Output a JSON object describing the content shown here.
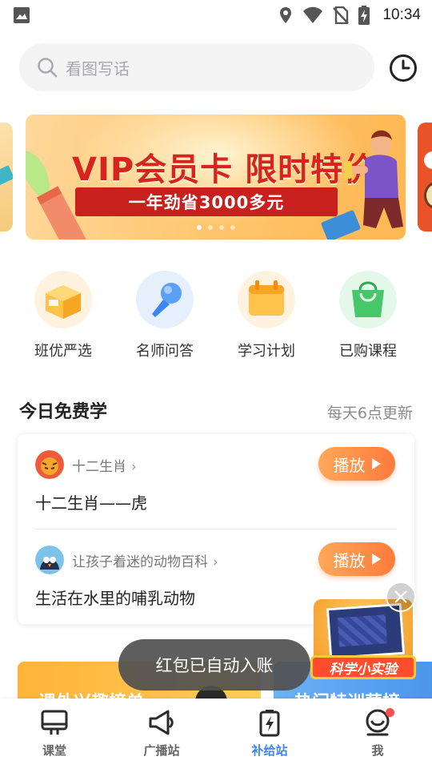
{
  "status_bar": {
    "time": "10:34",
    "icons": [
      "image-icon",
      "location-icon",
      "wifi-icon",
      "no-sim-icon",
      "battery-charging-icon"
    ]
  },
  "search": {
    "placeholder": "看图写话",
    "history_icon": "clock-icon"
  },
  "banner": {
    "headline": "VIP会员卡 限时特价",
    "subline": "一年劲省3000多元",
    "slide_count": 4,
    "active_slide": 1
  },
  "quick_entries": [
    {
      "label": "班优严选",
      "icon": "box-icon",
      "color": "#ffb536"
    },
    {
      "label": "名师问答",
      "icon": "microphone-icon",
      "color": "#5aa0f5"
    },
    {
      "label": "学习计划",
      "icon": "calendar-icon",
      "color": "#ffb536"
    },
    {
      "label": "已购课程",
      "icon": "shopping-bag-icon",
      "color": "#46c86a"
    }
  ],
  "free_section": {
    "title": "今日免费学",
    "note": "每天6点更新",
    "lessons": [
      {
        "series": "十二生肖",
        "title": "十二生肖——虎",
        "play_label": "播放"
      },
      {
        "series": "让孩子着迷的动物百科",
        "title": "生活在水里的哺乳动物",
        "play_label": "播放"
      }
    ]
  },
  "promos": {
    "left_text": "课外兴趣榜单",
    "right_text": "热门特训营榜"
  },
  "float_ad": {
    "label": "科学小实验"
  },
  "toast": {
    "text": "红包已自动入账"
  },
  "bottom_nav": {
    "active": "补给站",
    "items": [
      {
        "label": "课堂",
        "icon": "classroom-icon"
      },
      {
        "label": "广播站",
        "icon": "megaphone-icon"
      },
      {
        "label": "补给站",
        "icon": "battery-bolt-icon"
      },
      {
        "label": "我",
        "icon": "profile-smile-icon"
      }
    ]
  },
  "colors": {
    "accent_blue": "#3d86f2",
    "play_orange": "#ff7b3b",
    "banner_red": "#d8241f"
  }
}
